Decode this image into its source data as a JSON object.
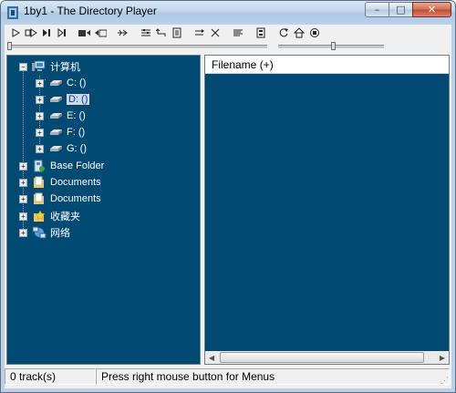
{
  "window": {
    "title": "1by1 - The Directory Player",
    "buttons": {
      "minimize": "–",
      "maximize": "□",
      "close": "✕"
    }
  },
  "toolbar": {
    "buttons": [
      {
        "name": "play-icon"
      },
      {
        "name": "play-next-icon"
      },
      {
        "name": "stop-next-icon"
      },
      {
        "name": "skip-next-icon"
      },
      {
        "name": "folder-back-icon"
      },
      {
        "name": "folder-forward-icon"
      },
      {
        "name": "jump-icon"
      },
      {
        "name": "settings-icon"
      },
      {
        "name": "enter-icon"
      },
      {
        "name": "document-icon"
      },
      {
        "name": "repeat-icon"
      },
      {
        "name": "shuffle-icon"
      },
      {
        "name": "list-icon"
      },
      {
        "name": "playlist-icon"
      },
      {
        "name": "refresh-icon"
      },
      {
        "name": "home-icon"
      },
      {
        "name": "stop-circle-icon"
      }
    ]
  },
  "sliders": {
    "position": 0.0,
    "volume": 0.55
  },
  "tree": {
    "root": {
      "label": "计算机"
    },
    "drives": [
      {
        "label": "C: ()"
      },
      {
        "label": "D: ()",
        "selected": true
      },
      {
        "label": "E: ()"
      },
      {
        "label": "F: ()"
      },
      {
        "label": "G: ()"
      }
    ],
    "folders": [
      {
        "label": "Base Folder"
      },
      {
        "label": "Documents"
      },
      {
        "label": "Documents"
      },
      {
        "label": "收藏夹"
      },
      {
        "label": "网络"
      }
    ]
  },
  "file_list": {
    "header": "Filename (+)"
  },
  "statusbar": {
    "tracks": "0 track(s)",
    "hint": "Press right mouse button for Menus"
  },
  "colors": {
    "pane_bg": "#004a73",
    "selection_bg": "#c7d9f0",
    "window_frame": "#bcd1e6"
  }
}
